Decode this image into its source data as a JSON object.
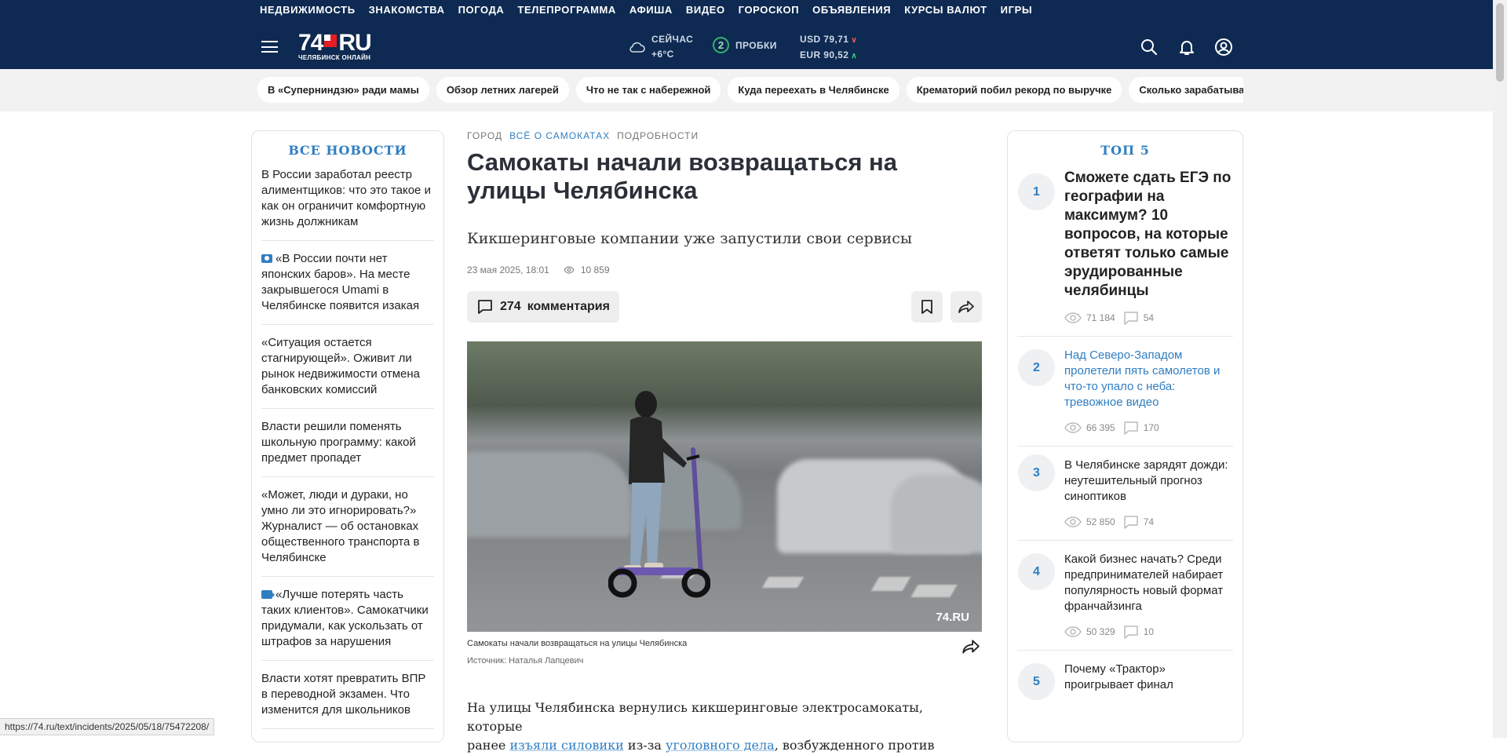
{
  "top_nav": {
    "links": [
      "НЕДВИЖИМОСТЬ",
      "ЗНАКОМСТВА",
      "ПОГОДА",
      "ТЕЛЕПРОГРАММА",
      "АФИША",
      "ВИДЕО",
      "ГОРОСКОП",
      "ОБЪЯВЛЕНИЯ",
      "КУРСЫ ВАЛЮТ",
      "ИГРЫ"
    ],
    "logo_main": "74",
    "logo_ru": "RU",
    "logo_sub": "ЧЕЛЯБИНСК ОНЛАЙН",
    "weather_label": "СЕЙЧАС",
    "weather_temp": "+6°C",
    "traffic_level": "2",
    "traffic_label": "ПРОБКИ",
    "usd": "USD 79,71",
    "eur": "EUR 90,52"
  },
  "quick_links": [
    "В «Суперниндзю» ради мамы",
    "Обзор летних лагерей",
    "Что не так с набережной",
    "Куда переехать в Челябинске",
    "Крематорий побил рекорд по выручке",
    "Сколько зарабатывают ректоры"
  ],
  "left": {
    "title": "ВСЕ НОВОСТИ",
    "items": [
      {
        "text": "В России заработал реестр алиментщиков: что это такое и как он ограничит комфортную жизнь должникам",
        "icon": ""
      },
      {
        "text": "«В России почти нет японских баров». На месте закрывшегося Umami в Челябинске появится изакая",
        "icon": "camera-icon"
      },
      {
        "text": "«Ситуация остается стагнирующей». Оживит ли рынок недвижимости отмена банковских комиссий",
        "icon": ""
      },
      {
        "text": "Власти решили поменять школьную программу: какой предмет пропадет",
        "icon": ""
      },
      {
        "text": "«Может, люди и дураки, но умно ли это игнорировать?» Журналист — об остановках общественного транспорта в Челябинске",
        "icon": ""
      },
      {
        "text": "«Лучше потерять часть таких клиентов». Самокатчики придумали, как ускользать от штрафов за нарушения",
        "icon": "video-icon"
      },
      {
        "text": "Власти хотят превратить ВПР в переводной экзамен. Что изменится для школьников",
        "icon": ""
      }
    ]
  },
  "article": {
    "rubrics": [
      "ГОРОД",
      "ВСЁ О САМОКАТАХ",
      "ПОДРОБНОСТИ"
    ],
    "headline": "Самокаты начали возвращаться на улицы Челябинска",
    "lead": "Кикшеринговые компании уже запустили свои сервисы",
    "date": "23 мая 2025, 18:01",
    "views": "10 859",
    "comments_count": "274",
    "comments_label": "комментария",
    "photo_watermark": "74.RU",
    "caption": "Самокаты начали возвращаться на улицы Челябинска",
    "source": "Источник: Наталья Лапцевич",
    "body_1": "На улицы Челябинска вернулись кикшеринговые электросамокаты, которые",
    "body_2a": "ранее ",
    "body_link1": "изъяли силовики",
    "body_2b": " из-за ",
    "body_link2": "уголовного дела",
    "body_2c": ", возбужденного против"
  },
  "right": {
    "title": "ТОП 5",
    "items": [
      {
        "num": "1",
        "title": "Сможете сдать ЕГЭ по географии на максимум? 10 вопросов, на которые ответят только самые эрудированные челябинцы",
        "views": "71 184",
        "comments": "54"
      },
      {
        "num": "2",
        "title": "Над Северо-Западом пролетели пять самолетов и что-то упало с неба: тревожное видео",
        "views": "66 395",
        "comments": "170"
      },
      {
        "num": "3",
        "title": "В Челябинске зарядят дожди: неутешительный прогноз синоптиков",
        "views": "52 850",
        "comments": "74"
      },
      {
        "num": "4",
        "title": "Какой бизнес начать? Среди предпринимателей набирает популярность новый формат франчайзинга",
        "views": "50 329",
        "comments": "10"
      },
      {
        "num": "5",
        "title": "Почему «Трактор» проигрывает финал",
        "views": "",
        "comments": ""
      }
    ]
  },
  "status_url": "https://74.ru/text/incidents/2025/05/18/75472208/",
  "colors": {
    "header": "#0e2a52",
    "accent": "#2f7ec2",
    "logo_red": "#e31e24"
  }
}
